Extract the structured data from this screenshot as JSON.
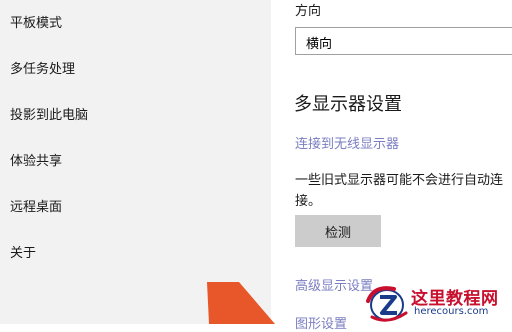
{
  "sidebar": {
    "items": [
      {
        "label": "平板模式"
      },
      {
        "label": "多任务处理"
      },
      {
        "label": "投影到此电脑"
      },
      {
        "label": "体验共享"
      },
      {
        "label": "远程桌面"
      },
      {
        "label": "关于"
      }
    ]
  },
  "main": {
    "orientation_label": "方向",
    "orientation_value": "横向",
    "multi_display_title": "多显示器设置",
    "connect_wireless_link": "连接到无线显示器",
    "legacy_desc_line1": "一些旧式显示器可能不会进行自动连",
    "legacy_desc_line2": "接。",
    "detect_button": "检测",
    "advanced_display_link": "高级显示设置",
    "graphics_settings_link": "图形设置"
  },
  "watermark": {
    "title": "这里教程网",
    "url": "herecours.com"
  },
  "colors": {
    "sidebar_bg": "#f2f2f2",
    "link": "#7a7ec0",
    "button_bg": "#cccccc",
    "arrow": "#e8572a",
    "watermark_red": "#c8102e",
    "watermark_blue": "#1a3a8a"
  },
  "icons": {
    "annotation_arrow": "arrow-icon",
    "watermark_logo": "z-logo-icon"
  }
}
